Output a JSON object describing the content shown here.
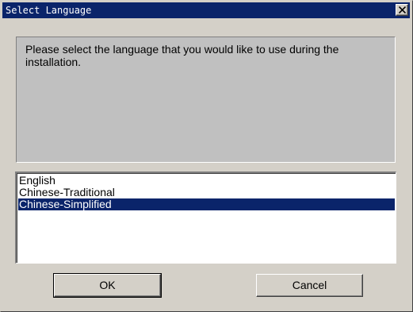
{
  "window": {
    "title": "Select Language",
    "close_icon": "close-icon"
  },
  "message": "Please select the language that you would like to use during the installation.",
  "languages": {
    "items": [
      "English",
      "Chinese-Traditional",
      "Chinese-Simplified"
    ],
    "selected": "Chinese-Simplified"
  },
  "buttons": {
    "ok_label": "OK",
    "cancel_label": "Cancel"
  },
  "colors": {
    "titlebar": "#0a246a",
    "selection": "#0a246a",
    "dialog_face": "#d4d0c8",
    "message_panel": "#c0c0c0"
  }
}
